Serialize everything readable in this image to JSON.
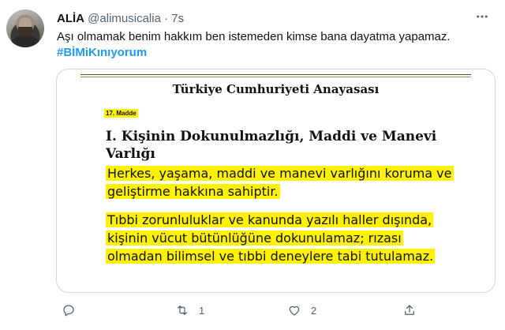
{
  "tweet": {
    "display_name": "ALİA",
    "handle": "@alimusicalia",
    "separator": "·",
    "time": "7s",
    "more_icon": "ellipsis-icon",
    "text": "Aşı olmamak benim hakkım ben istemeden kimse bana dayatma yapamaz.",
    "hashtag": "#BİMiKınıyorum"
  },
  "media": {
    "title": "Türkiye Cumhuriyeti Anayasası",
    "article": "17. Madde",
    "heading": "I. Kişinin Dokunulmazlığı, Maddi ve Manevi Varlığı",
    "paragraph_1": "Herkes, yaşama, maddi ve manevi varlığını koruma ve geliştirme hakkına sahiptir.",
    "paragraph_2": "Tıbbi zorunluluklar ve kanunda yazılı haller dışında, kişinin vücut bütünlüğüne dokunulamaz; rızası olmadan bilimsel ve tıbbi deneylere tabi tutulamaz.",
    "highlight_color": "#fff200"
  },
  "actions": {
    "reply_icon": "reply-icon",
    "reply_count": "",
    "retweet_icon": "retweet-icon",
    "retweet_count": "1",
    "like_icon": "heart-icon",
    "like_count": "2",
    "share_icon": "share-icon",
    "share_count": ""
  },
  "colors": {
    "text": "#0f1419",
    "secondary": "#536471",
    "link": "#1d9bf0",
    "border": "#cfd9de"
  }
}
